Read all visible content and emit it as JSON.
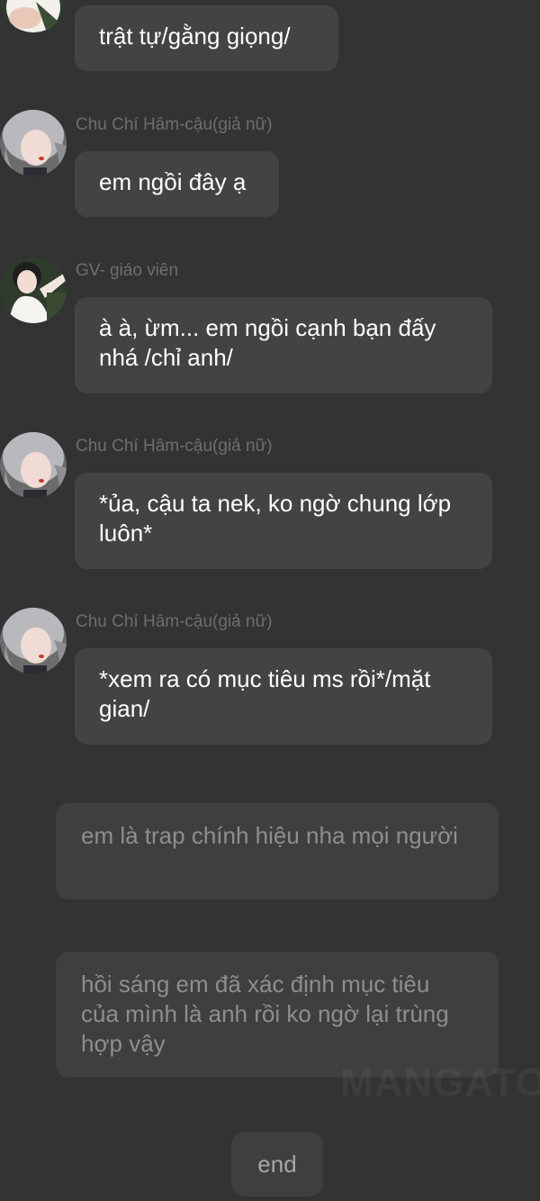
{
  "messages": [
    {
      "sender": "",
      "text": "trật tự/gằng giọng/",
      "avatar": "teacher-avatar"
    },
    {
      "sender": "Chu Chí Hâm-cậu(giả nữ)",
      "text": "em ngồi đây ạ",
      "avatar": "girl-avatar"
    },
    {
      "sender": "GV- giáo viên",
      "text": "à à, ừm... em ngồi cạnh bạn đấy nhá /chỉ anh/",
      "avatar": "teacher-avatar"
    },
    {
      "sender": "Chu Chí Hâm-cậu(giả nữ)",
      "text": "*ủa, cậu ta nek, ko ngờ chung lớp luôn*",
      "avatar": "girl-avatar"
    },
    {
      "sender": "Chu Chí Hâm-cậu(giả nữ)",
      "text": "*xem ra có mục tiêu ms rồi*/mặt gian/",
      "avatar": "girl-avatar"
    }
  ],
  "narrations": [
    "em là trap chính hiệu nha mọi người",
    "hồi sáng em đã xác định mục tiêu của mình là anh rồi ko ngờ lại trùng hợp vậy"
  ],
  "end_button": {
    "label": "end"
  },
  "watermark": "MANGATOON",
  "colors": {
    "background": "#333333",
    "bubble": "#434343",
    "narration_bubble": "#3f3f3f",
    "sender_text": "#6e6e6e",
    "message_text": "#ffffff",
    "narration_text": "#8e8e8e"
  }
}
